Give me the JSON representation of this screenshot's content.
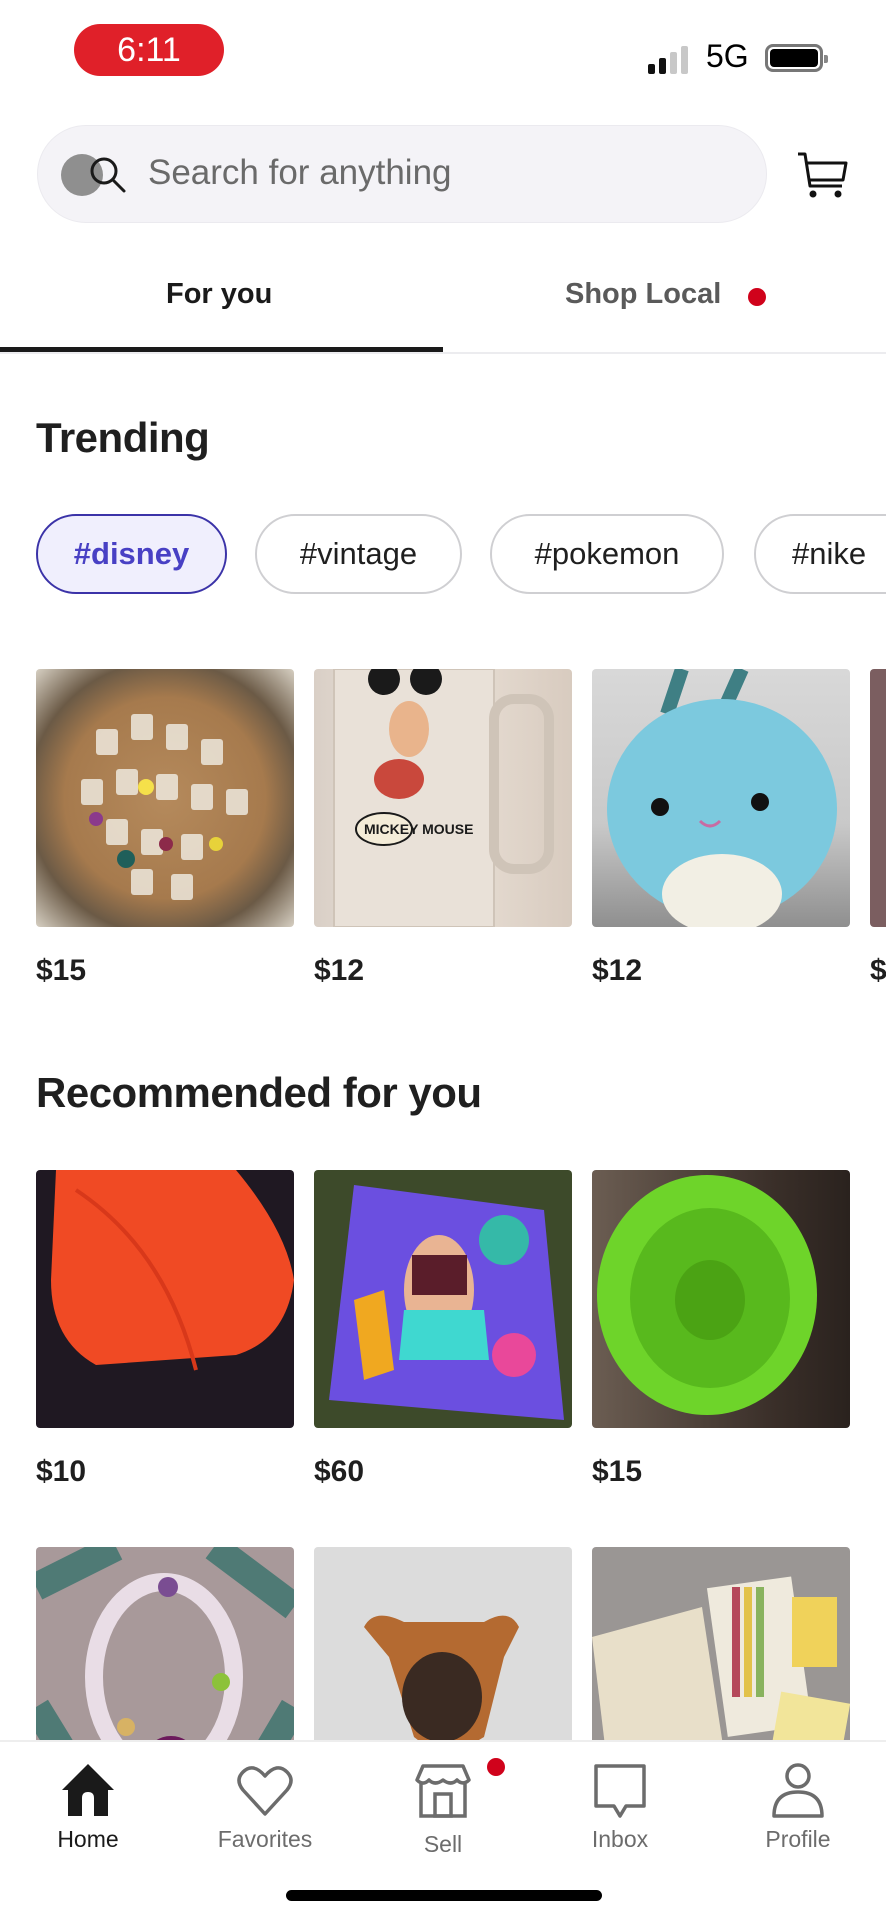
{
  "status_bar": {
    "time": "6:11",
    "network": "5G",
    "signal_bars_active": 2,
    "signal_bars_total": 4,
    "battery_level": 1.0
  },
  "search": {
    "placeholder": "Search for anything",
    "search_icon": "search-icon",
    "cart_icon": "cart-icon"
  },
  "tabs": [
    {
      "label": "For you",
      "selected": true
    },
    {
      "label": "Shop Local",
      "selected": false,
      "has_notification_dot": true
    }
  ],
  "trending": {
    "title": "Trending",
    "chips": [
      {
        "label": "#disney",
        "selected": true
      },
      {
        "label": "#vintage",
        "selected": false
      },
      {
        "label": "#pokemon",
        "selected": false
      },
      {
        "label": "#nike",
        "selected": false
      }
    ],
    "items": [
      {
        "price": "$15",
        "image": "disney-pins-lot"
      },
      {
        "price": "$12",
        "image": "mickey-mouse-glass-mug"
      },
      {
        "price": "$12",
        "image": "blue-squishmallow-plush"
      },
      {
        "price": "$",
        "image": "partially-visible-item"
      }
    ]
  },
  "recommended": {
    "title": "Recommended for you",
    "items": [
      {
        "price": "$10",
        "image": "orange-knit-hat"
      },
      {
        "price": "$60",
        "image": "painted-canvas-art"
      },
      {
        "price": "$15",
        "image": "green-silicone-bowl"
      },
      {
        "price": "",
        "image": "beaded-bracelet"
      },
      {
        "price": "",
        "image": "dog-plush-on-blanket"
      },
      {
        "price": "",
        "image": "scrapbook-sticker-sheets"
      }
    ]
  },
  "bottom_nav": [
    {
      "label": "Home",
      "icon": "home-icon",
      "active": true
    },
    {
      "label": "Favorites",
      "icon": "heart-icon",
      "active": false
    },
    {
      "label": "Sell",
      "icon": "storefront-icon",
      "active": false,
      "has_notification_dot": true
    },
    {
      "label": "Inbox",
      "icon": "inbox-icon",
      "active": false
    },
    {
      "label": "Profile",
      "icon": "profile-icon",
      "active": false
    }
  ],
  "colors": {
    "accent_red": "#d0021b",
    "chip_selected": "#4840c4",
    "time_pill": "#e02029"
  }
}
